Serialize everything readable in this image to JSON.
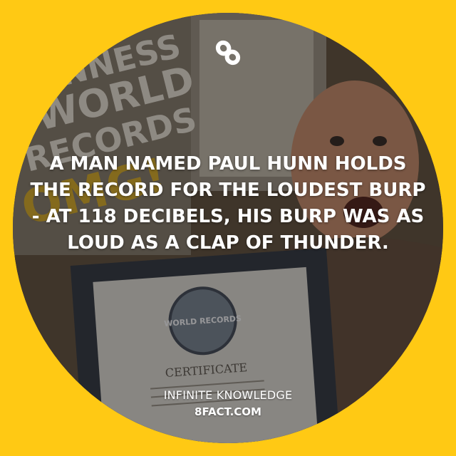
{
  "colors": {
    "background_yellow": "#FFC914",
    "text_white": "#FFFFFF",
    "logo_white": "#FFFFFF"
  },
  "logo": {
    "icon": "infinity-8-logo-icon"
  },
  "photo": {
    "sign_text": [
      "INNESS",
      "WORLD",
      "RECORDS",
      "OMG!"
    ],
    "seal_text": "WORLD RECORDS",
    "certificate_title": "CERTIFICATE"
  },
  "fact": {
    "text": "A MAN NAMED PAUL HUNN HOLDS THE RECORD FOR THE LOUDEST BURP - AT 118 DECIBELS, HIS BURP WAS AS LOUD AS A CLAP OF THUNDER."
  },
  "brand": {
    "name": "INFINITE KNOWLEDGE",
    "url": "8FACT.COM"
  }
}
